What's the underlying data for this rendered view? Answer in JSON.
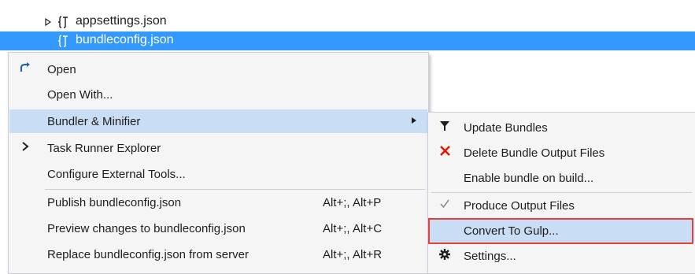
{
  "tree": {
    "items": [
      {
        "label": "appsettings.json",
        "icon": "json-file-icon",
        "expander": "▷"
      },
      {
        "label": "bundleconfig.json",
        "icon": "json-file-icon",
        "selected": true
      }
    ],
    "selection_color": "#3399ff"
  },
  "context_menu": {
    "items": [
      {
        "label": "Open",
        "icon": "open-arrow-icon"
      },
      {
        "label": "Open With..."
      },
      {
        "label": "Bundler & Minifier",
        "has_submenu": true,
        "active": true
      },
      {
        "label": "Task Runner Explorer",
        "icon": "chevron-right-icon"
      },
      {
        "label": "Configure External Tools..."
      },
      {
        "label": "Publish bundleconfig.json",
        "shortcut": "Alt+;, Alt+P"
      },
      {
        "label": "Preview changes to bundleconfig.json",
        "shortcut": "Alt+;, Alt+C"
      },
      {
        "label": "Replace bundleconfig.json from server",
        "shortcut": "Alt+;, Alt+R"
      }
    ]
  },
  "submenu": {
    "items": [
      {
        "label": "Update Bundles",
        "icon": "funnel-icon"
      },
      {
        "label": "Delete Bundle Output Files",
        "icon": "red-x-icon"
      },
      {
        "label": "Enable bundle on build..."
      },
      {
        "label": "Produce Output Files",
        "icon": "checkmark-icon"
      },
      {
        "label": "Convert To Gulp...",
        "highlighted": true
      },
      {
        "label": "Settings...",
        "icon": "gear-icon"
      }
    ],
    "highlight_color": "#e2423c",
    "active_color": "#c9def5"
  }
}
